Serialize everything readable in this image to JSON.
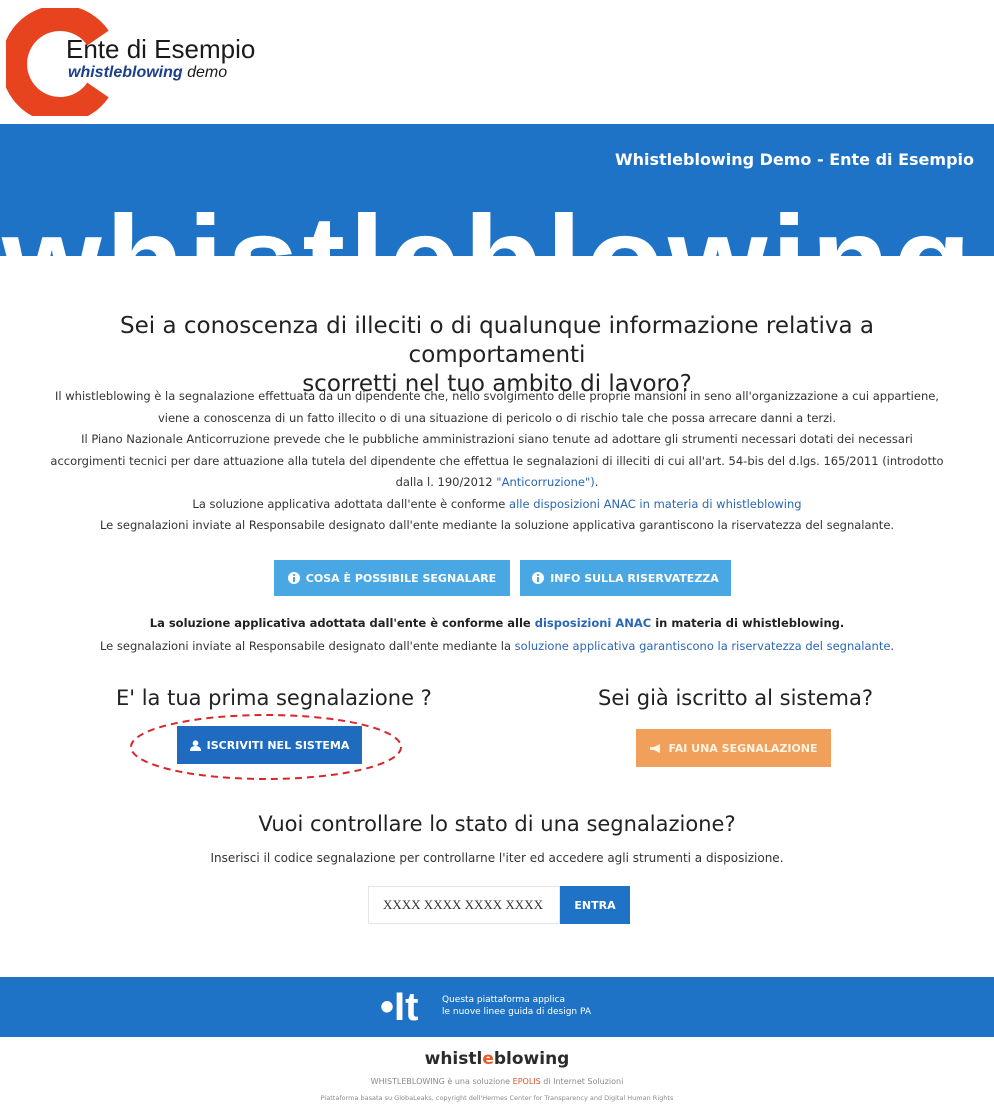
{
  "logo": {
    "title": "Ente di Esempio",
    "subtitle_brand": "whistleblowing",
    "subtitle_rest": "demo"
  },
  "banner": {
    "title": "Whistleblowing Demo - Ente di Esempio",
    "word": "whistleblowing"
  },
  "intro": {
    "heading_line1": "Sei a conoscenza di illeciti o di qualunque informazione relativa a comportamenti",
    "heading_line2": "scorretti nel tuo ambito di lavoro?",
    "p1": "Il whistleblowing è la segnalazione effettuata da un dipendente che, nello svolgimento delle proprie mansioni in seno all'organizzazione a cui appartiene,",
    "p2": "viene a conoscenza di un fatto illecito o di una situazione di pericolo o di rischio tale che possa arrecare danni a terzi.",
    "p3": "Il Piano Nazionale Anticorruzione prevede che le pubbliche amministrazioni siano tenute ad adottare gli strumenti necessari dotati dei necessari",
    "p4": "accorgimenti tecnici per dare attuazione alla tutela del dipendente che effettua le segnalazioni di illeciti di cui all'art. 54-bis del d.lgs. 165/2011 (introdotto",
    "p5a": "dalla l. 190/2012 ",
    "p5_link": "\"Anticorruzione\")",
    "p5b": ".",
    "p6a": "La soluzione applicativa adottata dall'ente è conforme ",
    "p6_link": "alle disposizioni ANAC in materia di whistleblowing",
    "p7": "Le segnalazioni inviate al Responsabile designato dall'ente mediante la soluzione applicativa garantiscono la riservatezza del segnalante."
  },
  "buttons": {
    "cosa": "COSA È POSSIBILE SEGNALARE",
    "info": "INFO SULLA RISERVATEZZA",
    "iscriviti": "ISCRIVITI NEL SISTEMA",
    "fai": "FAI UNA SEGNALAZIONE",
    "entra": "ENTRA"
  },
  "notice": {
    "l1a": "La soluzione applicativa adottata dall'ente è conforme alle ",
    "l1_link": "disposizioni ANAC",
    "l1b": " in materia di whistleblowing.",
    "l2a": "Le segnalazioni inviate al Responsabile designato dall'ente mediante la ",
    "l2_link": "soluzione applicativa garantiscono la riservatezza del segnalante",
    "l2b": "."
  },
  "first_time": {
    "heading": "E' la tua prima segnalazione ?"
  },
  "already": {
    "heading": "Sei già iscritto al sistema?"
  },
  "check": {
    "heading": "Vuoi controllare lo stato di una segnalazione?",
    "text": "Inserisci il codice segnalazione per controllarne l'iter ed accedere agli strumenti a disposizione.",
    "placeholder": "XXXX XXXX XXXX XXXX"
  },
  "footer": {
    "it_logo": "•It",
    "note": "Questa piattaforma applica\nle nuove linee guida di design PA",
    "brand_a": "whistl",
    "brand_dot": "e",
    "brand_b": "blowing",
    "line1a": "WHISTLEBLOWING è una soluzione ",
    "line1_red": "EPOLIS",
    "line1b": " di Internet Soluzioni",
    "line2": "Piattaforma basata su GlobaLeaks, copyright dell'Hermes Center for Transparency and Digital Human Rights"
  },
  "colors": {
    "brand_blue": "#1f73c7",
    "light_blue": "#49a8e4",
    "orange": "#f0a05a",
    "logo_red": "#e8431f"
  },
  "icons": [
    "info-circle-icon",
    "user-icon",
    "megaphone-icon"
  ]
}
